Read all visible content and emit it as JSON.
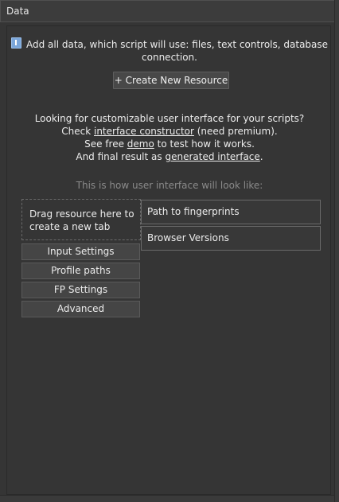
{
  "panel": {
    "title": "Data"
  },
  "info": {
    "icon": "info-icon",
    "text_line1": "Add all data, which script will use: files, text controls, database",
    "text_line2": "connection."
  },
  "toolbar": {
    "create_label": "+ Create New Resource"
  },
  "help": {
    "line1": "Looking for customizable user interface for your scripts?",
    "line2_prefix": "Check ",
    "line2_link": "interface constructor",
    "line2_suffix": " (need premium).",
    "line3_prefix": "See free ",
    "line3_link": "demo",
    "line3_suffix": " to test how it works.",
    "line4_prefix": "And final result as ",
    "line4_link": "generated interface",
    "line4_suffix": "."
  },
  "preview": {
    "caption": "This is how user interface will look like:",
    "drag_line1": "Drag resource here to",
    "drag_line2": "create a new tab",
    "tabs": [
      {
        "label": "Input Settings"
      },
      {
        "label": "Profile paths"
      },
      {
        "label": "FP Settings"
      },
      {
        "label": "Advanced"
      }
    ],
    "fields": [
      {
        "label": "Path to fingerprints"
      },
      {
        "label": "Browser Versions"
      }
    ]
  }
}
